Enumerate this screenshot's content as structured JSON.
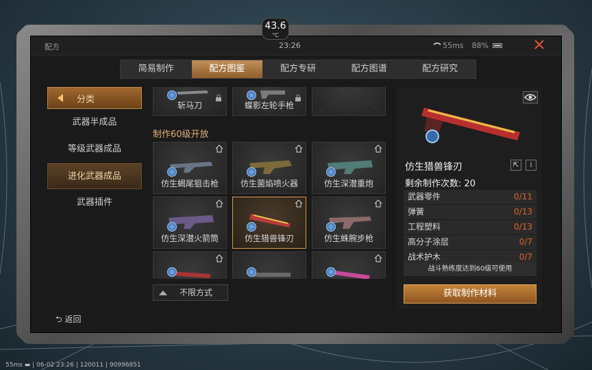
{
  "temperature": {
    "value": "43.6",
    "unit": "°C"
  },
  "status_bar": {
    "title": "配方",
    "time": "23:26",
    "ping": "55ms",
    "battery": "88%"
  },
  "tabs": [
    {
      "label": "简易制作"
    },
    {
      "label": "配方图鉴"
    },
    {
      "label": "配方专研"
    },
    {
      "label": "配方图谱"
    },
    {
      "label": "配方研究"
    }
  ],
  "categories": {
    "header": "分类",
    "items": [
      {
        "label": "武器半成品"
      },
      {
        "label": "等级武器成品"
      },
      {
        "label": "进化武器成品"
      },
      {
        "label": "武器插件"
      }
    ]
  },
  "back_label": "返回",
  "grid": {
    "top_items": [
      {
        "name": "斩马刀"
      },
      {
        "name": "蝶影左轮手枪"
      }
    ],
    "section_title": "制作60级开放",
    "rows": [
      [
        {
          "name": "仿生蝎尾狙击枪"
        },
        {
          "name": "仿生菌焰喷火器"
        },
        {
          "name": "仿生深潜重炮"
        }
      ],
      [
        {
          "name": "仿生深潜火箭筒"
        },
        {
          "name": "仿生猎兽锋刃"
        },
        {
          "name": "仿生蛛腕步枪"
        }
      ]
    ]
  },
  "filter_label": "不限方式",
  "detail": {
    "name": "仿生猎兽锋刃",
    "remaining_label": "剩余制作次数: 20",
    "materials": [
      {
        "name": "武器零件",
        "count": "0/11"
      },
      {
        "name": "弹簧",
        "count": "0/13"
      },
      {
        "name": "工程塑料",
        "count": "0/13"
      },
      {
        "name": "高分子涂层",
        "count": "0/7"
      },
      {
        "name": "战术护木",
        "count": "0/7"
      }
    ],
    "requirement": "战斗熟练度达到60级可使用",
    "action_button": "获取制作材料"
  },
  "footer": "55ms ▬ | 06-02 23:26 | 120011 | 90996851",
  "colors": {
    "accent": "#c4843a",
    "close": "#e0562e",
    "counter": "#e0632e"
  }
}
